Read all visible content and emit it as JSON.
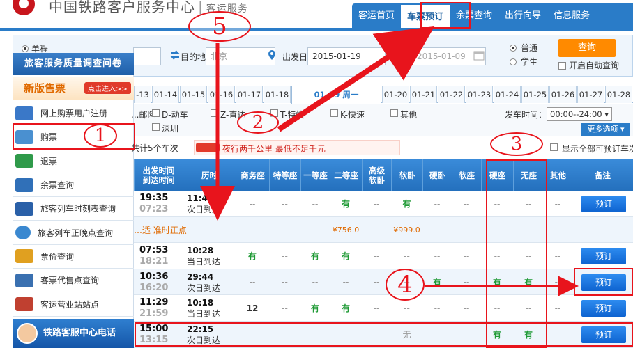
{
  "header": {
    "brand": "中国铁路客户服务中心",
    "sub": "客运服务",
    "nav": [
      "客运首页",
      "车票预订",
      "余票查询",
      "出行向导",
      "信息服务"
    ]
  },
  "query": {
    "trip_type": "单程",
    "to_label": "目的地",
    "to_value": "北京",
    "date_label": "出发日",
    "depart_date": "2015-01-19",
    "return_date": "2015-01-09",
    "passenger_normal": "普通",
    "passenger_student": "学生",
    "search_button": "查询",
    "auto_query": "开启自动查询"
  },
  "sidebar": {
    "survey": "旅客服务质量调查问卷",
    "new_version": "新版售票",
    "new_version_badge": "点击进入>>",
    "items": [
      {
        "label": "网上购票用户注册",
        "color": "#3a78c8"
      },
      {
        "label": "购票",
        "color": "#4a90d0"
      },
      {
        "label": "退票",
        "color": "#2f9a4a"
      },
      {
        "label": "余票查询",
        "color": "#3070b8"
      },
      {
        "label": "旅客列车时刻表查询",
        "color": "#2a60a8"
      },
      {
        "label": "旅客列车正晚点查询",
        "color": "#3a88d0"
      },
      {
        "label": "票价查询",
        "color": "#e0a020"
      },
      {
        "label": "客票代售点查询",
        "color": "#3a70b0"
      },
      {
        "label": "客运营业站站点",
        "color": "#c04030"
      }
    ],
    "hotline": "铁路客服中心电话"
  },
  "dates": {
    "cells": [
      "-13",
      "01-14",
      "01-15",
      "01-16",
      "01-17",
      "01-18",
      "01-19 周一",
      "01-20",
      "01-21",
      "01-22",
      "01-23",
      "01-24",
      "01-25",
      "01-26",
      "01-27",
      "01-28"
    ],
    "active_index": 6
  },
  "filters": {
    "types_row1": [
      "...邮际",
      "D-动车",
      "Z-直达",
      "T-特快",
      "K-快速",
      "其他"
    ],
    "types_row2": [
      "深圳"
    ],
    "depart_time_label": "发车时间：",
    "depart_time_value": "00:00--24:00",
    "more_options": "更多选项"
  },
  "info": {
    "count_text": "共计5个车次",
    "notice": "夜行两千公里 最低不足千元",
    "show_all": "显示全部可预订车次"
  },
  "table": {
    "headers": [
      "出发时间\n到达时间",
      "历时",
      "商务座",
      "特等座",
      "一等座",
      "二等座",
      "高级\n软卧",
      "软卧",
      "硬卧",
      "软座",
      "硬座",
      "无座",
      "其他",
      "备注"
    ],
    "book_label": "预订",
    "rows": [
      {
        "t1": "19:35",
        "t2": "07:23",
        "d1": "11:48",
        "d2": "次日到达",
        "seats": [
          "--",
          "--",
          "--",
          "有",
          "--",
          "有",
          "--",
          "--",
          "--",
          "--",
          "--"
        ],
        "book": true
      },
      {
        "extra": "…适 准时正点",
        "seats": [
          "",
          "",
          "",
          "¥756.0",
          "",
          "¥999.0",
          "",
          "",
          "",
          "",
          ""
        ],
        "book": false
      },
      {
        "t1": "07:53",
        "t2": "18:21",
        "d1": "10:28",
        "d2": "当日到达",
        "seats": [
          "有",
          "--",
          "有",
          "有",
          "--",
          "--",
          "--",
          "--",
          "--",
          "--",
          "--"
        ],
        "book": true
      },
      {
        "t1": "10:36",
        "t2": "16:20",
        "d1": "29:44",
        "d2": "次日到达",
        "seats": [
          "--",
          "--",
          "--",
          "--",
          "--",
          "--",
          "有",
          "--",
          "有",
          "有",
          "--"
        ],
        "book": true
      },
      {
        "t1": "11:29",
        "t2": "21:59",
        "d1": "10:18",
        "d2": "当日到达",
        "seats": [
          "12",
          "--",
          "有",
          "有",
          "--",
          "--",
          "--",
          "--",
          "--",
          "--",
          "--"
        ],
        "book": true
      },
      {
        "t1": "15:00",
        "t2": "13:15",
        "d1": "22:15",
        "d2": "次日到达",
        "seats": [
          "--",
          "--",
          "--",
          "--",
          "--",
          "无",
          "--",
          "--",
          "有",
          "有",
          "--"
        ],
        "book": true
      }
    ]
  },
  "annotations": [
    "1",
    "2",
    "3",
    "4",
    "5"
  ],
  "colors": {
    "accent": "#2a7cc8",
    "annotation": "#e8141c",
    "available": "#1f9a35",
    "button": "#ff8a00"
  }
}
